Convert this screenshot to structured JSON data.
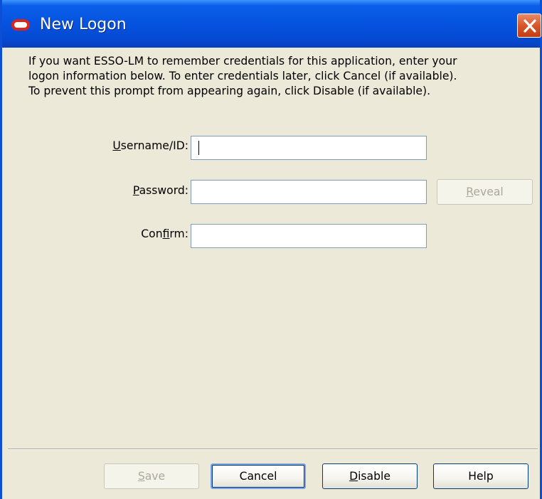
{
  "window": {
    "title": "New Logon",
    "close_label": "Close"
  },
  "intro": {
    "line1": "If you want ESSO-LM to remember credentials for this application, enter your",
    "line2": "logon information below. To enter credentials later, click Cancel (if available).",
    "line3": "To prevent this prompt from appearing again, click Disable (if available)."
  },
  "form": {
    "username": {
      "label_mnemonic": "U",
      "label_rest": "sername/ID:",
      "value": ""
    },
    "password": {
      "label_mnemonic": "P",
      "label_rest": "assword:",
      "value": ""
    },
    "confirm": {
      "label_pre": "Con",
      "label_mnemonic": "f",
      "label_rest": "irm:",
      "value": ""
    },
    "reveal": {
      "mnemonic": "R",
      "rest": "eveal",
      "enabled": false
    }
  },
  "buttons": {
    "save": {
      "mnemonic": "S",
      "rest": "ave",
      "enabled": false
    },
    "cancel": {
      "label": "Cancel",
      "enabled": true
    },
    "disable": {
      "mnemonic": "D",
      "rest": "isable",
      "enabled": true
    },
    "help": {
      "label": "Help",
      "enabled": true
    }
  },
  "colors": {
    "titlebar": "#0553e0",
    "close_button": "#d9562a",
    "oracle_logo": "#d9261c",
    "dialog_background": "#ece9d8",
    "disabled_text": "#aca899"
  },
  "icons": {
    "app_icon": "oracle-logo-icon",
    "close_icon": "close-x-icon"
  }
}
